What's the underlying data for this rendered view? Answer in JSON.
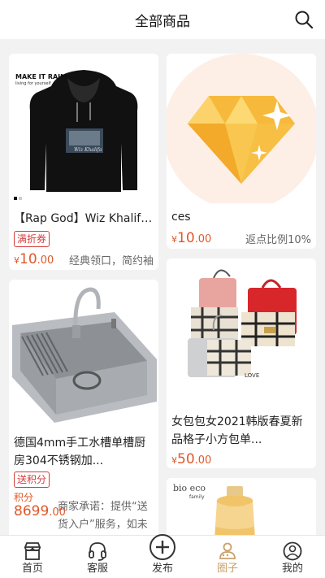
{
  "header": {
    "title": "全部商品",
    "search_icon": "search-icon"
  },
  "products": [
    {
      "name": "【Rap God】Wiz Khalifa...",
      "tag": "满折券",
      "currency": "¥",
      "price_int": "10",
      "price_dec": ".00",
      "desc": "经典领口，简约袖",
      "image_text": "MAKE IT RAIN",
      "image_subtext": "living for yourself"
    },
    {
      "name": "ces",
      "currency": "¥",
      "price_int": "10",
      "price_dec": ".00",
      "desc": "返点比例10%",
      "image": "diamond-icon"
    },
    {
      "name": "德国4mm手工水槽单槽厨房304不锈钢加...",
      "tag": "送积分",
      "points_label": "积分",
      "price_int": "8699",
      "price_dec": ".00",
      "desc": "商家承诺：提供“送货入户”服务，如未"
    },
    {
      "name": "女包包女2021韩版春夏新品格子小方包单...",
      "currency": "¥",
      "price_int": "50",
      "price_dec": ".00"
    },
    {
      "name": "",
      "image_text": "bio eco",
      "image_subtext": "family"
    }
  ],
  "tabbar": [
    {
      "label": "首页",
      "icon": "shop-icon"
    },
    {
      "label": "客服",
      "icon": "headset-icon"
    },
    {
      "label": "发布",
      "icon": "plus-circle-icon"
    },
    {
      "label": "圈子",
      "icon": "people-icon",
      "active": true
    },
    {
      "label": "我的",
      "icon": "user-icon"
    }
  ],
  "colors": {
    "accent": "#e0582a",
    "tag": "#d53c3c",
    "active_tab": "#c9a06a"
  }
}
